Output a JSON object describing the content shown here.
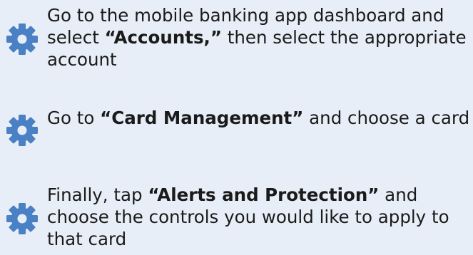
{
  "steps": [
    {
      "icon": "gear-icon",
      "text_before": "Go to the mobile banking app dashboard and select ",
      "bold": "“Accounts,”",
      "text_after": " then select the appropriate account"
    },
    {
      "icon": "gear-icon",
      "text_before": "Go to ",
      "bold": "“Card Management”",
      "text_after": " and choose a card"
    },
    {
      "icon": "gear-icon",
      "text_before": "Finally, tap ",
      "bold": "“Alerts and Protection”",
      "text_after": " and choose the controls you would like to apply to that card"
    }
  ],
  "colors": {
    "background": "#e8eef7",
    "icon": "#4a80c4",
    "text": "#1a1a1a"
  }
}
